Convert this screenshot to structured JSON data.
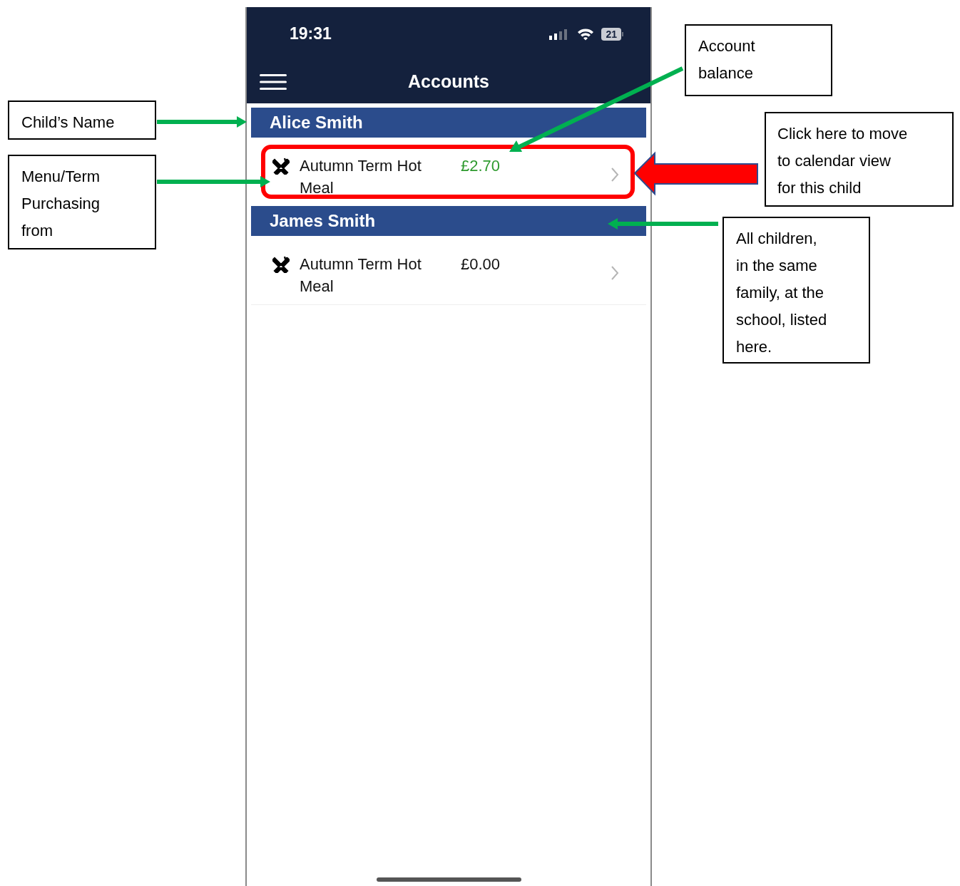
{
  "status_bar": {
    "time": "19:31",
    "battery": "21"
  },
  "header": {
    "title": "Accounts"
  },
  "accounts": [
    {
      "child": "Alice Smith",
      "items": [
        {
          "name": "Autumn Term Hot Meal",
          "balance": "£2.70",
          "in_credit": true,
          "highlighted": true
        }
      ]
    },
    {
      "child": "James Smith",
      "items": [
        {
          "name": "Autumn Term Hot Meal",
          "balance": "£0.00",
          "in_credit": false,
          "highlighted": false
        }
      ]
    }
  ],
  "callouts": [
    {
      "text": "Child’s Name"
    },
    {
      "text": "Menu/Term\nPurchasing\nfrom"
    },
    {
      "text": "Account\nbalance"
    },
    {
      "text": "Click here to move\nto calendar view\nfor this child"
    },
    {
      "text": "All children,\nin the same\nfamily, at the\nschool, listed\nhere."
    }
  ]
}
